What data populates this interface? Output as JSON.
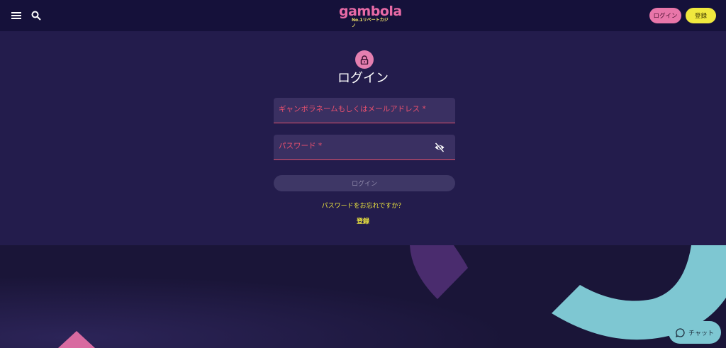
{
  "header": {
    "menu_icon": "hamburger-menu-icon",
    "search_icon": "search-icon",
    "logo_text": "gambola",
    "logo_tagline": "No.1リベートカジノ",
    "login_label": "ログイン",
    "register_label": "登録"
  },
  "login_form": {
    "lock_icon": "lock-icon",
    "title": "ログイン",
    "username_label": "ギャンボラネームもしくはメールアドレス *",
    "password_label": "パスワード *",
    "toggle_visibility_icon": "eye-off-icon",
    "submit_label": "ログイン",
    "forgot_password": "パスワードをお忘れですか？",
    "register_link": "登録"
  },
  "chat": {
    "icon": "chat-bubble-icon",
    "label": "チャット"
  },
  "colors": {
    "header_bg": "#15113a",
    "panel_bg": "#231c4c",
    "page_bg": "#1d1840",
    "pink": "#e876a9",
    "yellow": "#f0e83e",
    "error_red": "#e8506e",
    "teal": "#7ec7d2"
  }
}
